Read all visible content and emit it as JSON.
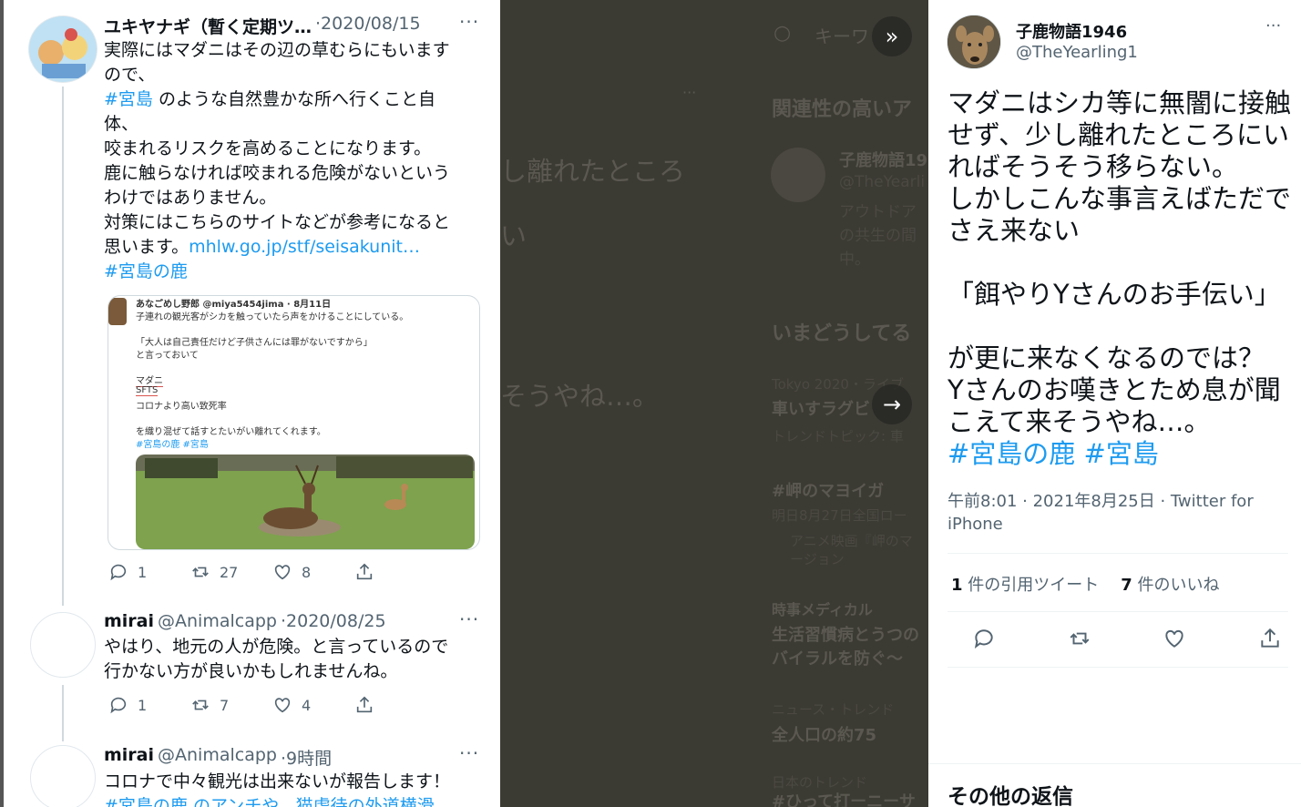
{
  "left": {
    "tweet1": {
      "name": "ユキヤナギ（暫く定期ツ…",
      "date": "·2020/08/15",
      "lines": [
        "実際にはマダニはその辺の草むらにもいます",
        "ので、"
      ],
      "line3_tag": "#宮島",
      "line3_text": " のような自然豊かな所へ行くこと自",
      "lines2": [
        "体、",
        "咬まれるリスクを高めることになります。",
        "鹿に触らなければ咬まれる危険がないという",
        "わけではありません。",
        "対策にはこちらのサイトなどが参考になると"
      ],
      "line_link_prefix": "思います。",
      "link": "mhlw.go.jp/stf/seisakunit…",
      "tag2": "#宮島の鹿",
      "quote": {
        "header": "あなごめし野郎 @miya5454jima · 8月11日",
        "l1": "子連れの観光客がシカを触っていたら声をかけることにしている。",
        "l2": "「大人は自己責任だけど子供さんには罪がないですから」",
        "l3": "と言っておいて",
        "l4": "マダニ",
        "l5": "SFTS",
        "l6": "コロナより高い致死率",
        "l7": "を織り混ぜて話すとたいがい離れてくれます。",
        "l8": "#宮島の鹿 #宮島"
      },
      "replies": "1",
      "retweets": "27",
      "likes": "8"
    },
    "tweet2": {
      "name": "mirai",
      "handle": "@Animalcapp",
      "date": "·2020/08/25",
      "lines": [
        "やはり、地元の人が危険。と言っているので",
        "行かない方が良いかもしれませんね。"
      ],
      "replies": "1",
      "retweets": "7",
      "likes": "4"
    },
    "tweet3": {
      "name": "mirai",
      "handle": "@Animalcapp",
      "date": "·9時間",
      "line1": "コロナで中々観光は出来ないが報告します！",
      "line2": "#宮島の鹿 のアンチや、猫虐待の外道横滑"
    }
  },
  "backdrop": {
    "search": "キーワ",
    "related": "関連性の高いア",
    "rel_name": "子鹿物語19",
    "rel_handle": "@TheYearli",
    "rel_bio1": "アウトドア",
    "rel_bio2": "の共生の間",
    "rel_bio3": "中。",
    "big1": "し離れたところ",
    "big2": "い",
    "big3": "そうやね…。",
    "whatsup": "いまどうしてる",
    "t1_meta": "Tokyo 2020・ライブ",
    "t1_title": "車いすラグビ",
    "t1_sub": "トレンドトピック: 車",
    "t2_title": "#岬のマヨイガ",
    "t2_sub": "明日8月27日全国ロー",
    "t2_sub2": "アニメ映画『岬のマ",
    "t2_sub3": "ージョン",
    "t3_meta": "時事メディカル",
    "t3_title": "生活習慣病とうつの",
    "t3_title2": "バイラルを防ぐ〜",
    "t4_meta": "ニュース・トレンド",
    "t4_title": "全人口の約75",
    "t5_meta": "日本のトレンド",
    "t5_title": "#ひって打ーニーサ"
  },
  "right": {
    "name": "子鹿物語1946",
    "handle": "@TheYearling1",
    "more": "···",
    "body": [
      "マダニはシカ等に無闇に接触",
      "せず、少し離れたところにい",
      "ればそうそう移らない。",
      "しかしこんな事言えばただで",
      "さえ来ない",
      "",
      "「餌やりYさんのお手伝い」",
      "",
      "が更に来なくなるのでは？",
      "Yさんのお嘆きとため息が聞",
      "こえて来そうやね…。"
    ],
    "tags": "#宮島の鹿 #宮島",
    "meta1": "午前8:01 · 2021年8月25日 · Twitter for",
    "meta2": "iPhone",
    "quote_count": "1",
    "quote_label": "件の引用ツイート",
    "like_count": "7",
    "like_label": "件のいいね",
    "more_replies": "その他の返信"
  },
  "colors": {
    "link": "#1d9bf0",
    "overlay": "#3b3a33",
    "muted": "#536471"
  }
}
